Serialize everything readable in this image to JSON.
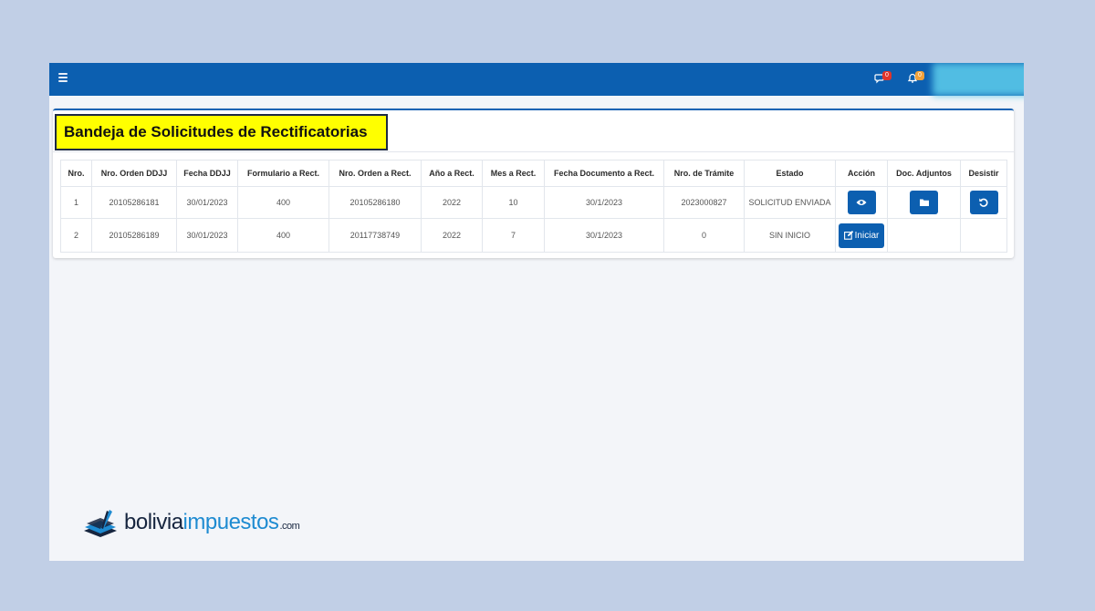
{
  "topbar": {
    "messages_badge": "0",
    "notifications_badge": "0",
    "messages_badge_color": "#e0352a",
    "notifications_badge_color": "#f0a13a"
  },
  "page": {
    "title": "Bandeja de Solicitudes de Rectificatorias"
  },
  "table": {
    "headers": [
      "Nro.",
      "Nro. Orden DDJJ",
      "Fecha DDJJ",
      "Formulario a Rect.",
      "Nro. Orden a Rect.",
      "Año a Rect.",
      "Mes a Rect.",
      "Fecha Documento a Rect.",
      "Nro. de Trámite",
      "Estado",
      "Acción",
      "Doc. Adjuntos",
      "Desistir"
    ],
    "rows": [
      {
        "nro": "1",
        "orden_ddjj": "20105286181",
        "fecha_ddjj": "30/01/2023",
        "formulario": "400",
        "orden_rect": "20105286180",
        "anio": "2022",
        "mes": "10",
        "fecha_doc": "30/1/2023",
        "tramite": "2023000827",
        "estado": "SOLICITUD ENVIADA",
        "accion_icon": "eye-icon",
        "adjuntos_icon": "folder-icon",
        "desistir_icon": "undo-icon"
      },
      {
        "nro": "2",
        "orden_ddjj": "20105286189",
        "fecha_ddjj": "30/01/2023",
        "formulario": "400",
        "orden_rect": "20117738749",
        "anio": "2022",
        "mes": "7",
        "fecha_doc": "30/1/2023",
        "tramite": "0",
        "estado": "SIN INICIO",
        "accion_label": "Iniciar",
        "accion_icon": "edit-icon"
      }
    ]
  },
  "watermark": {
    "part1": "bolivia",
    "part2": "impuestos",
    "part3": ".com",
    "color_dark": "#16253f",
    "color_blue": "#1e8bd1"
  },
  "colors": {
    "primary": "#0c5fb0",
    "highlight": "#ffff00",
    "background": "#c1cfe6"
  }
}
